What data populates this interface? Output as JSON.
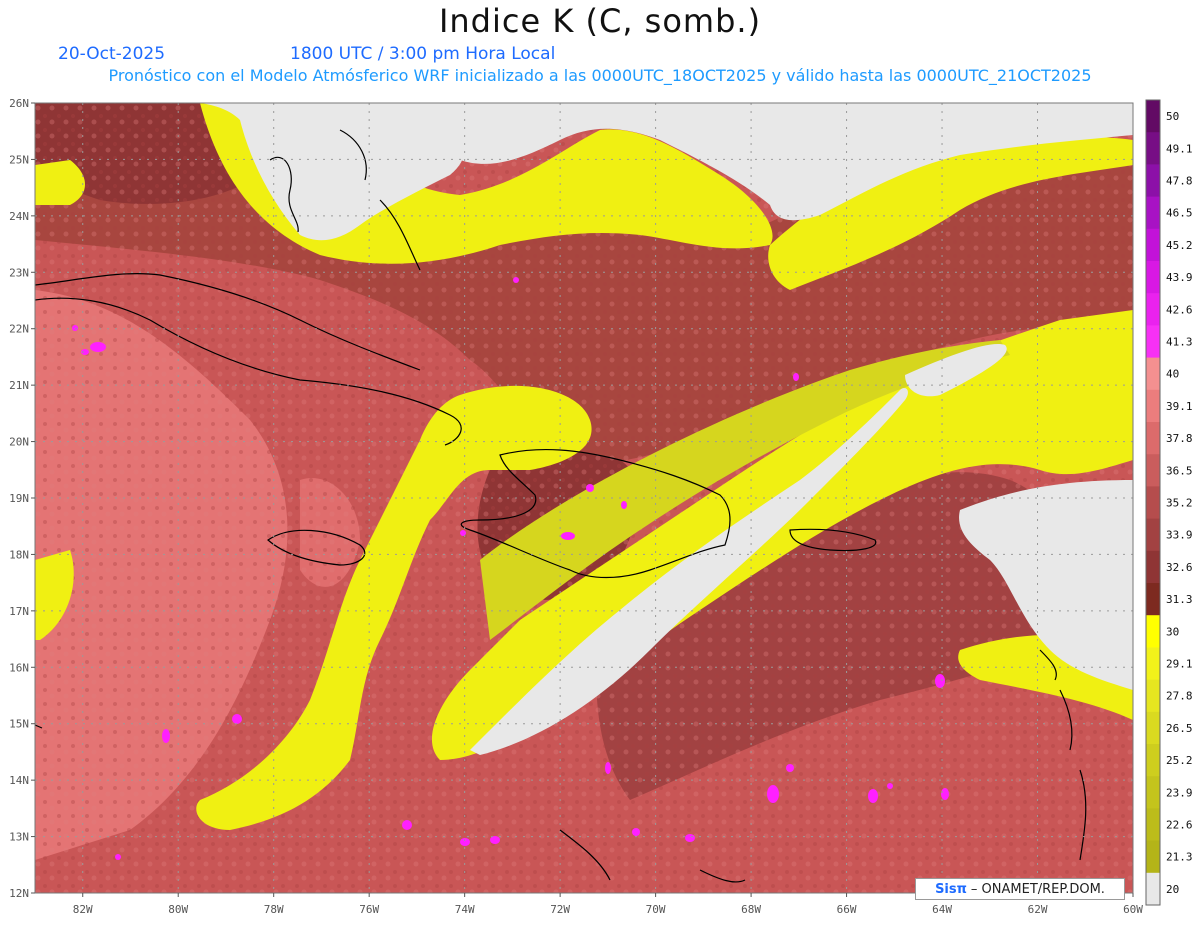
{
  "header": {
    "title": "Indice K (C, somb.)",
    "date": "20-Oct-2025",
    "time": "1800 UTC / 3:00 pm Hora Local",
    "description": "Pronóstico con el Modelo Atmósferico WRF inicializado a las 0000UTC_18OCT2025 y válido hasta las  0000UTC_21OCT2025"
  },
  "map": {
    "lat_labels": [
      "26N",
      "25N",
      "24N",
      "23N",
      "22N",
      "21N",
      "20N",
      "19N",
      "18N",
      "17N",
      "16N",
      "15N",
      "14N",
      "13N",
      "12N"
    ],
    "lon_labels": [
      "82W",
      "80W",
      "78W",
      "76W",
      "74W",
      "72W",
      "70W",
      "68W",
      "66W",
      "64W",
      "62W",
      "60W"
    ],
    "lat_range": [
      12,
      26
    ],
    "lon_range": [
      -83,
      -60
    ]
  },
  "colorbar": {
    "levels": [
      "50",
      "49.1",
      "47.8",
      "46.5",
      "45.2",
      "43.9",
      "42.6",
      "41.3",
      "40",
      "39.1",
      "37.8",
      "36.5",
      "35.2",
      "33.9",
      "32.6",
      "31.3",
      "30",
      "29.1",
      "27.8",
      "26.5",
      "25.2",
      "23.9",
      "22.6",
      "21.3",
      "20"
    ],
    "colors": [
      "#620a64",
      "#770e85",
      "#8c10a8",
      "#a812c4",
      "#c212d8",
      "#d818e4",
      "#ea22ee",
      "#f730f5",
      "#f49090",
      "#ec7d7d",
      "#dc6b6b",
      "#ca5d5d",
      "#b54d4d",
      "#a24242",
      "#8f3535",
      "#7d2a20",
      "#ffff00",
      "#f2f21a",
      "#e6e620",
      "#dada20",
      "#cece1e",
      "#c4c41c",
      "#bcbc1a",
      "#b4b418",
      "#e8e8e8"
    ]
  },
  "credit": {
    "brand": "Sisπ",
    "rest": "– ONAMET/REP.DOM."
  }
}
